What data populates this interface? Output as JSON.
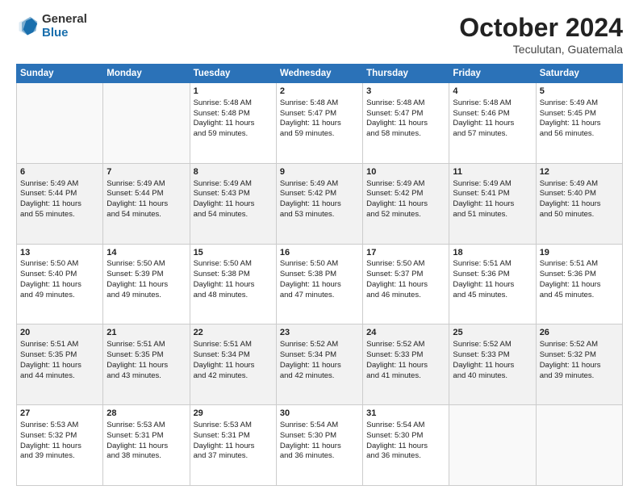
{
  "header": {
    "logo_general": "General",
    "logo_blue": "Blue",
    "month": "October 2024",
    "location": "Teculutan, Guatemala"
  },
  "weekdays": [
    "Sunday",
    "Monday",
    "Tuesday",
    "Wednesday",
    "Thursday",
    "Friday",
    "Saturday"
  ],
  "weeks": [
    [
      {
        "day": "",
        "info": ""
      },
      {
        "day": "",
        "info": ""
      },
      {
        "day": "1",
        "info": "Sunrise: 5:48 AM\nSunset: 5:48 PM\nDaylight: 11 hours\nand 59 minutes."
      },
      {
        "day": "2",
        "info": "Sunrise: 5:48 AM\nSunset: 5:47 PM\nDaylight: 11 hours\nand 59 minutes."
      },
      {
        "day": "3",
        "info": "Sunrise: 5:48 AM\nSunset: 5:47 PM\nDaylight: 11 hours\nand 58 minutes."
      },
      {
        "day": "4",
        "info": "Sunrise: 5:48 AM\nSunset: 5:46 PM\nDaylight: 11 hours\nand 57 minutes."
      },
      {
        "day": "5",
        "info": "Sunrise: 5:49 AM\nSunset: 5:45 PM\nDaylight: 11 hours\nand 56 minutes."
      }
    ],
    [
      {
        "day": "6",
        "info": "Sunrise: 5:49 AM\nSunset: 5:44 PM\nDaylight: 11 hours\nand 55 minutes."
      },
      {
        "day": "7",
        "info": "Sunrise: 5:49 AM\nSunset: 5:44 PM\nDaylight: 11 hours\nand 54 minutes."
      },
      {
        "day": "8",
        "info": "Sunrise: 5:49 AM\nSunset: 5:43 PM\nDaylight: 11 hours\nand 54 minutes."
      },
      {
        "day": "9",
        "info": "Sunrise: 5:49 AM\nSunset: 5:42 PM\nDaylight: 11 hours\nand 53 minutes."
      },
      {
        "day": "10",
        "info": "Sunrise: 5:49 AM\nSunset: 5:42 PM\nDaylight: 11 hours\nand 52 minutes."
      },
      {
        "day": "11",
        "info": "Sunrise: 5:49 AM\nSunset: 5:41 PM\nDaylight: 11 hours\nand 51 minutes."
      },
      {
        "day": "12",
        "info": "Sunrise: 5:49 AM\nSunset: 5:40 PM\nDaylight: 11 hours\nand 50 minutes."
      }
    ],
    [
      {
        "day": "13",
        "info": "Sunrise: 5:50 AM\nSunset: 5:40 PM\nDaylight: 11 hours\nand 49 minutes."
      },
      {
        "day": "14",
        "info": "Sunrise: 5:50 AM\nSunset: 5:39 PM\nDaylight: 11 hours\nand 49 minutes."
      },
      {
        "day": "15",
        "info": "Sunrise: 5:50 AM\nSunset: 5:38 PM\nDaylight: 11 hours\nand 48 minutes."
      },
      {
        "day": "16",
        "info": "Sunrise: 5:50 AM\nSunset: 5:38 PM\nDaylight: 11 hours\nand 47 minutes."
      },
      {
        "day": "17",
        "info": "Sunrise: 5:50 AM\nSunset: 5:37 PM\nDaylight: 11 hours\nand 46 minutes."
      },
      {
        "day": "18",
        "info": "Sunrise: 5:51 AM\nSunset: 5:36 PM\nDaylight: 11 hours\nand 45 minutes."
      },
      {
        "day": "19",
        "info": "Sunrise: 5:51 AM\nSunset: 5:36 PM\nDaylight: 11 hours\nand 45 minutes."
      }
    ],
    [
      {
        "day": "20",
        "info": "Sunrise: 5:51 AM\nSunset: 5:35 PM\nDaylight: 11 hours\nand 44 minutes."
      },
      {
        "day": "21",
        "info": "Sunrise: 5:51 AM\nSunset: 5:35 PM\nDaylight: 11 hours\nand 43 minutes."
      },
      {
        "day": "22",
        "info": "Sunrise: 5:51 AM\nSunset: 5:34 PM\nDaylight: 11 hours\nand 42 minutes."
      },
      {
        "day": "23",
        "info": "Sunrise: 5:52 AM\nSunset: 5:34 PM\nDaylight: 11 hours\nand 42 minutes."
      },
      {
        "day": "24",
        "info": "Sunrise: 5:52 AM\nSunset: 5:33 PM\nDaylight: 11 hours\nand 41 minutes."
      },
      {
        "day": "25",
        "info": "Sunrise: 5:52 AM\nSunset: 5:33 PM\nDaylight: 11 hours\nand 40 minutes."
      },
      {
        "day": "26",
        "info": "Sunrise: 5:52 AM\nSunset: 5:32 PM\nDaylight: 11 hours\nand 39 minutes."
      }
    ],
    [
      {
        "day": "27",
        "info": "Sunrise: 5:53 AM\nSunset: 5:32 PM\nDaylight: 11 hours\nand 39 minutes."
      },
      {
        "day": "28",
        "info": "Sunrise: 5:53 AM\nSunset: 5:31 PM\nDaylight: 11 hours\nand 38 minutes."
      },
      {
        "day": "29",
        "info": "Sunrise: 5:53 AM\nSunset: 5:31 PM\nDaylight: 11 hours\nand 37 minutes."
      },
      {
        "day": "30",
        "info": "Sunrise: 5:54 AM\nSunset: 5:30 PM\nDaylight: 11 hours\nand 36 minutes."
      },
      {
        "day": "31",
        "info": "Sunrise: 5:54 AM\nSunset: 5:30 PM\nDaylight: 11 hours\nand 36 minutes."
      },
      {
        "day": "",
        "info": ""
      },
      {
        "day": "",
        "info": ""
      }
    ]
  ]
}
